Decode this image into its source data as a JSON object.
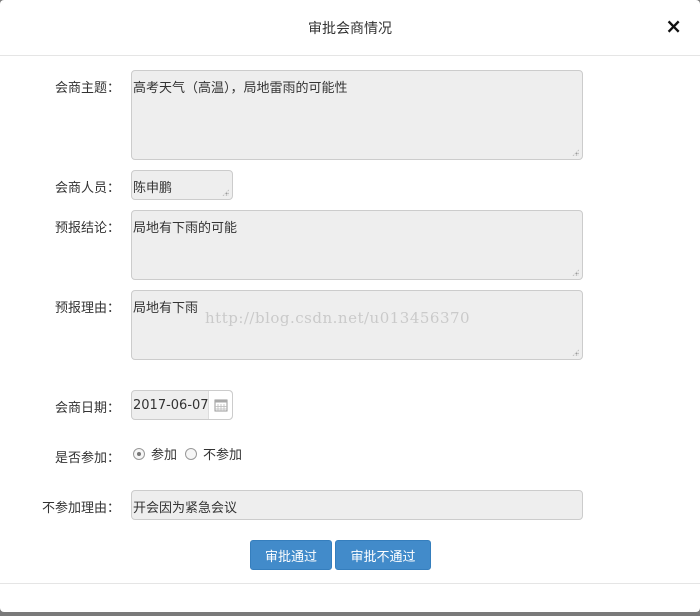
{
  "dialog": {
    "title": "审批会商情况",
    "close_label": "×"
  },
  "form": {
    "topic": {
      "label": "会商主题：",
      "value": "高考天气（高温），局地雷雨的可能性"
    },
    "personnel": {
      "label": "会商人员：",
      "value": "陈申鹏"
    },
    "conclusion": {
      "label": "预报结论：",
      "value": "局地有下雨的可能"
    },
    "reason": {
      "label": "预报理由：",
      "value": "局地有下雨"
    },
    "date": {
      "label": "会商日期：",
      "value": "2017-06-07"
    },
    "participate": {
      "label": "是否参加：",
      "options": [
        "参加",
        "不参加"
      ],
      "selected": "参加"
    },
    "absence_reason": {
      "label": "不参加理由：",
      "value": "开会因为紧急会议"
    }
  },
  "buttons": {
    "approve": "审批通过",
    "reject": "审批不通过"
  },
  "watermark": "http://blog.csdn.net/u013456370",
  "colors": {
    "primary_button": "#428bca",
    "field_background": "#eeeeee"
  }
}
